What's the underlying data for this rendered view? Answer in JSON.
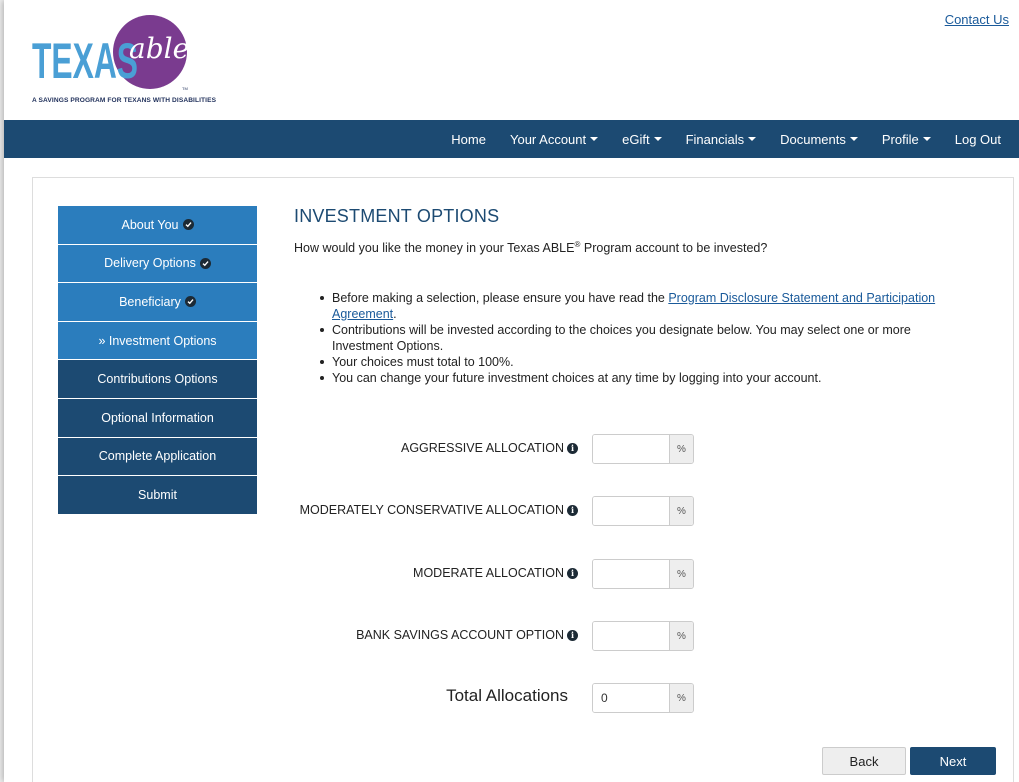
{
  "header": {
    "contact_label": "Contact Us",
    "logo_word_1": "TEXAS",
    "logo_word_2": "able",
    "logo_tagline": "A SAVINGS PROGRAM FOR TEXANS WITH DISABILITIES",
    "logo_tm": "TM"
  },
  "nav": {
    "items": [
      {
        "label": "Home",
        "dropdown": false
      },
      {
        "label": "Your Account",
        "dropdown": true
      },
      {
        "label": "eGift",
        "dropdown": true
      },
      {
        "label": "Financials",
        "dropdown": true
      },
      {
        "label": "Documents",
        "dropdown": true
      },
      {
        "label": "Profile",
        "dropdown": true
      },
      {
        "label": "Log Out",
        "dropdown": false
      }
    ]
  },
  "sidebar": {
    "items": [
      {
        "label": "About You",
        "state": "done"
      },
      {
        "label": "Delivery Options",
        "state": "done"
      },
      {
        "label": "Beneficiary",
        "state": "done"
      },
      {
        "label": "» Investment Options",
        "state": "active"
      },
      {
        "label": "Contributions Options",
        "state": "pending"
      },
      {
        "label": "Optional Information",
        "state": "pending"
      },
      {
        "label": "Complete Application",
        "state": "pending"
      },
      {
        "label": "Submit",
        "state": "pending"
      }
    ]
  },
  "main": {
    "title": "INVESTMENT OPTIONS",
    "question_before": "How would you like the money in your Texas ABLE",
    "question_reg": "®",
    "question_after": " Program account to be invested?",
    "bullets": {
      "b1_text": "Before making a selection, please ensure you have read the ",
      "b1_link": "Program Disclosure Statement and Participation Agreement",
      "b1_end": ".",
      "b2_text": "Contributions will be invested according to the choices you designate below. You may select one or more Investment Options.",
      "b3_text": "Your choices must total to 100%.",
      "b4_text": "You can change your future investment choices at any time by logging into your account."
    },
    "allocations": [
      {
        "label": "AGGRESSIVE ALLOCATION",
        "value": ""
      },
      {
        "label": "MODERATELY CONSERVATIVE ALLOCATION",
        "value": ""
      },
      {
        "label": "MODERATE ALLOCATION",
        "value": ""
      },
      {
        "label": "BANK SAVINGS ACCOUNT OPTION",
        "value": ""
      }
    ],
    "info_glyph": "i",
    "percent_symbol": "%",
    "total_label": "Total Allocations",
    "total_value": "0"
  },
  "buttons": {
    "back_label": "Back",
    "next_label": "Next"
  },
  "colors": {
    "navy": "#1c4a72",
    "blue": "#2b7dbd",
    "link": "#1a5a9a"
  }
}
